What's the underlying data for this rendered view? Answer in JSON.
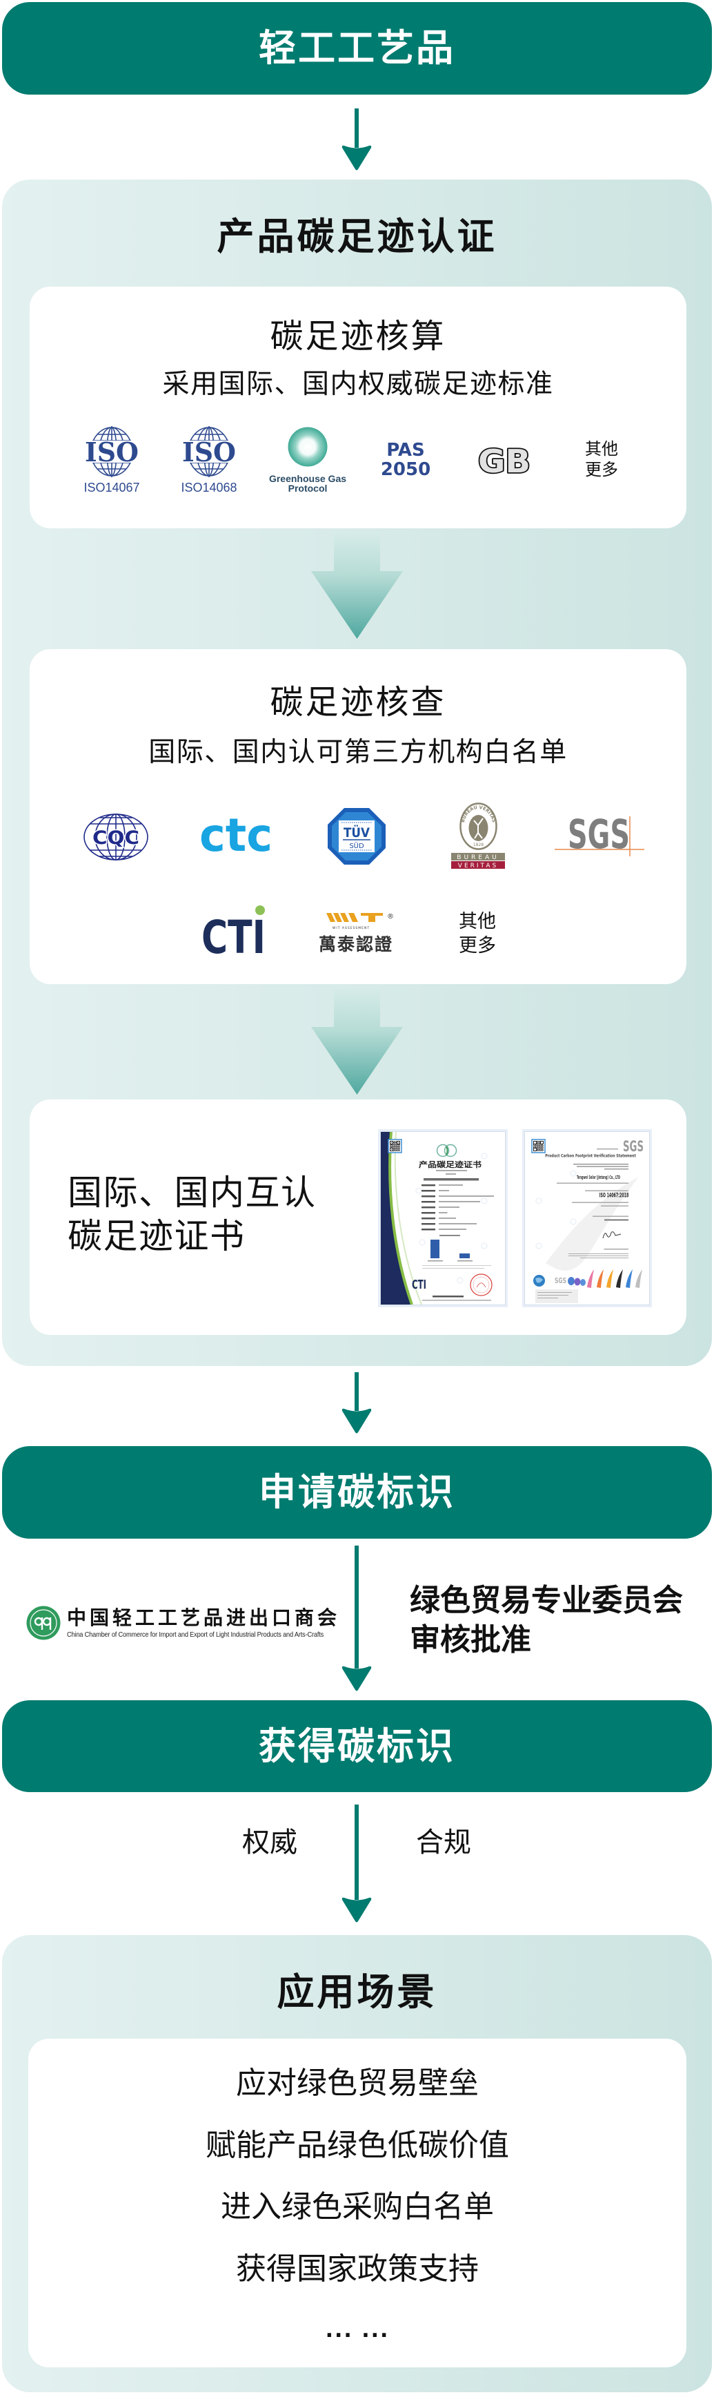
{
  "colors": {
    "teal": "#007B6F",
    "panel-left": "#E3F1F0",
    "panel-right": "#CCE4E1",
    "iso-blue": "#2E4A8F"
  },
  "flow": {
    "product": {
      "label": "轻工工艺品"
    },
    "certification": {
      "title": "产品碳足迹认证",
      "accounting": {
        "title": "碳足迹核算",
        "subtitle": "采用国际、国内权威碳足迹标准",
        "standards": [
          {
            "id": "iso-14067",
            "icon": "iso-globe-logo",
            "mark": "ISO",
            "caption": "ISO14067"
          },
          {
            "id": "iso-14068",
            "icon": "iso-globe-logo",
            "mark": "ISO",
            "caption": "ISO14068"
          },
          {
            "id": "ghg-protocol",
            "icon": "ghg-protocol-ring-logo",
            "caption_lines": [
              "Greenhouse Gas",
              "Protocol"
            ]
          },
          {
            "id": "pas-2050",
            "caption_lines": [
              "PAS",
              "2050"
            ]
          },
          {
            "id": "gb",
            "icon": "gb-national-standard-logo",
            "mark": "GB"
          },
          {
            "id": "more",
            "caption_lines": [
              "其他",
              "更多"
            ]
          }
        ]
      },
      "verification": {
        "title": "碳足迹核查",
        "subtitle": "国际、国内认可第三方机构白名单",
        "bodies": [
          {
            "id": "cqc",
            "icon": "cqc-globe-logo",
            "mark": "CQC"
          },
          {
            "id": "ctc",
            "icon": "ctc-logo",
            "mark": "ctc"
          },
          {
            "id": "tuv-sud",
            "icon": "tuv-octagon-logo",
            "mark": "TÜV",
            "sub_mark": "SÜD"
          },
          {
            "id": "bureau-veritas",
            "icon": "bureau-veritas-seal-logo",
            "arc_text": "BUREAU VERITAS",
            "year": "1828",
            "bar_lines": [
              "BUREAU",
              "VERITAS"
            ]
          },
          {
            "id": "sgs",
            "icon": "sgs-logo",
            "mark": "SGS"
          },
          {
            "id": "cti",
            "icon": "cti-logo",
            "mark": "CTI"
          },
          {
            "id": "wit",
            "icon": "wit-logo",
            "registered": "®",
            "tagline": "WIT ASSESSMENT",
            "name": "萬泰認證"
          },
          {
            "id": "more",
            "caption_lines": [
              "其他",
              "更多"
            ]
          }
        ]
      },
      "certificate": {
        "lines": [
          "国际、国内互认",
          "碳足迹证书"
        ],
        "samples": [
          {
            "id": "cti-carbon-footprint-certificate",
            "title": "产品碳足迹证书",
            "issuer": "CTI"
          },
          {
            "id": "sgs-verification-statement",
            "brand": "SGS",
            "title": "Product Carbon Footprint Verification Statement",
            "company": "Tongwei Solar (Jintang) Co., LTD",
            "standard": "ISO 14067:2018",
            "footer_brand": "SGS"
          }
        ]
      }
    },
    "apply": {
      "label": "申请碳标识"
    },
    "review": {
      "org_name_cn": "中国轻工工艺品进出口商会",
      "org_name_en": "China Chamber of Commerce for Import and Export of Light Industrial Products and Arts-Crafts",
      "lines": [
        "绿色贸易专业委员会",
        "审核批准"
      ]
    },
    "obtain": {
      "label": "获得碳标识"
    },
    "attributes": [
      "权威",
      "合规"
    ],
    "scenarios": {
      "title": "应用场景",
      "items": [
        "应对绿色贸易壁垒",
        "赋能产品绿色低碳价值",
        "进入绿色采购白名单",
        "获得国家政策支持"
      ],
      "more": "... ..."
    }
  }
}
